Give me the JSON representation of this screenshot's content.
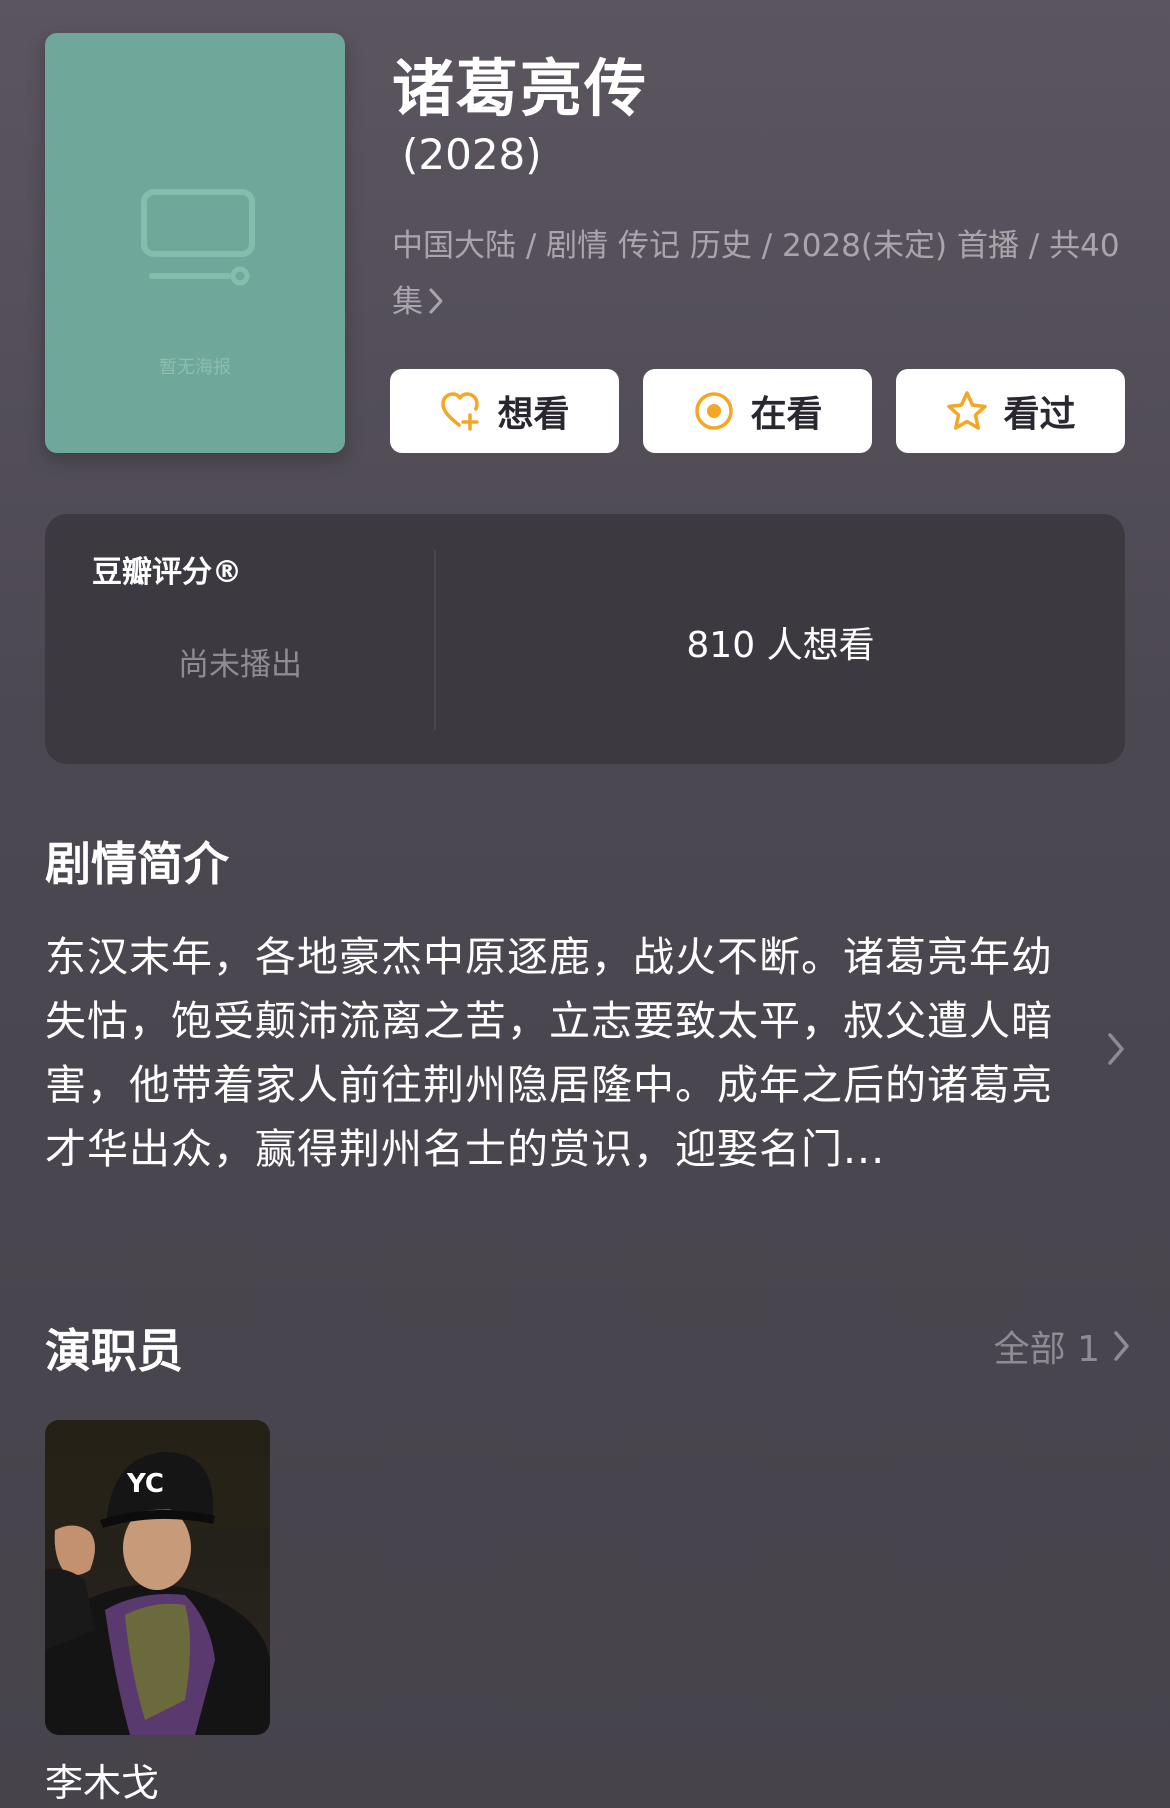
{
  "poster": {
    "placeholder_label": "暂无海报",
    "icon": "tv-icon",
    "background": "#6fa89a"
  },
  "title": "诸葛亮传",
  "year": "(2028)",
  "meta": "中国大陆 / 剧情 传记 历史 / 2028(未定) 首播 / 共40集",
  "actions": [
    {
      "label": "想看",
      "icon": "heart-plus-icon"
    },
    {
      "label": "在看",
      "icon": "target-icon"
    },
    {
      "label": "看过",
      "icon": "star-icon"
    }
  ],
  "accent_color": "#f5a623",
  "rating": {
    "brand": "豆瓣评分®",
    "status": "尚未播出",
    "want_count_text": "810 人想看"
  },
  "synopsis": {
    "heading": "剧情简介",
    "text": "东汉末年，各地豪杰中原逐鹿，战火不断。诸葛亮年幼失怙，饱受颠沛流离之苦，立志要致太平，叔父遭人暗害，他带着家人前往荆州隐居隆中。成年之后的诸葛亮才华出众，赢得荆州名士的赏识，迎娶名门..."
  },
  "cast": {
    "heading": "演职员",
    "all_label": "全部 1",
    "members": [
      {
        "name": "李木戈",
        "photo": "actor-photo"
      }
    ]
  }
}
